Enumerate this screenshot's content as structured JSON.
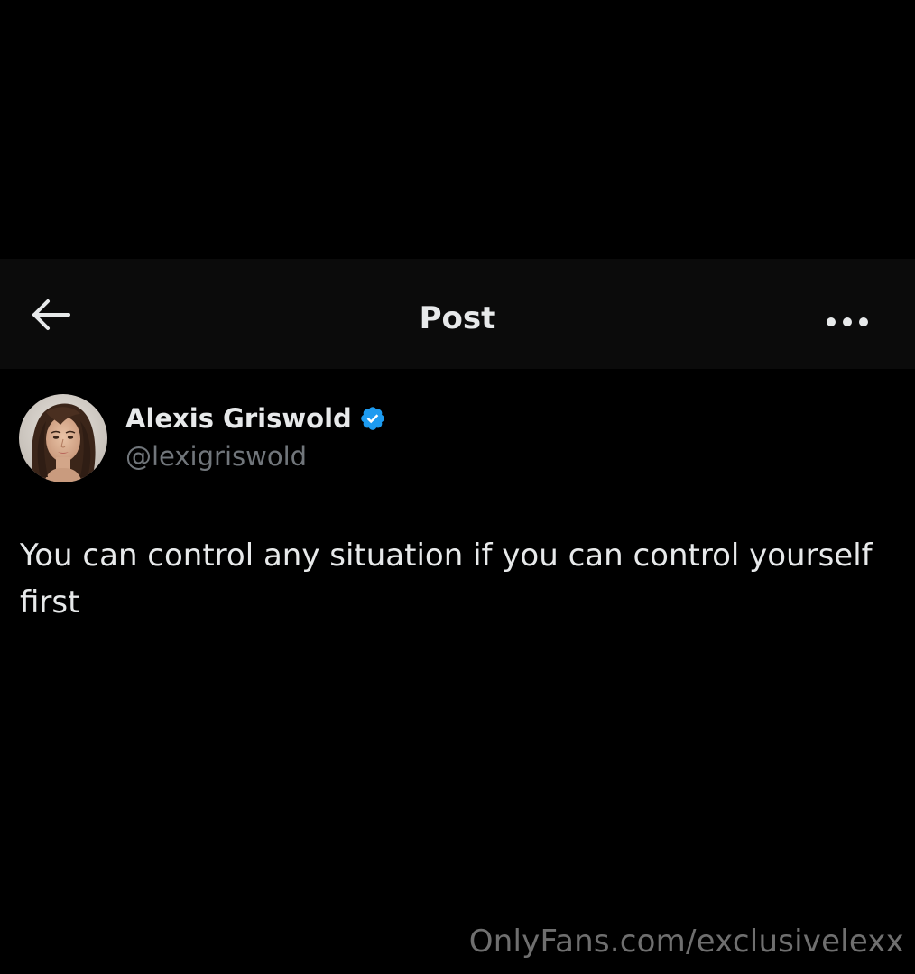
{
  "header": {
    "title": "Post",
    "back_icon": "arrow-left-icon",
    "more_icon": "more-horizontal-icon"
  },
  "author": {
    "display_name": "Alexis Griswold",
    "handle": "@lexigriswold",
    "verified_icon": "verified-badge-icon",
    "verified_color": "#1d9bf0"
  },
  "post": {
    "text": "You can control any situation if you can control yourself first"
  },
  "watermark": {
    "text": "OnlyFans.com/exclusivelexx"
  },
  "colors": {
    "background": "#000000",
    "header_background": "#0b0b0b",
    "primary_text": "#e7e9ea",
    "secondary_text": "#71767b"
  }
}
